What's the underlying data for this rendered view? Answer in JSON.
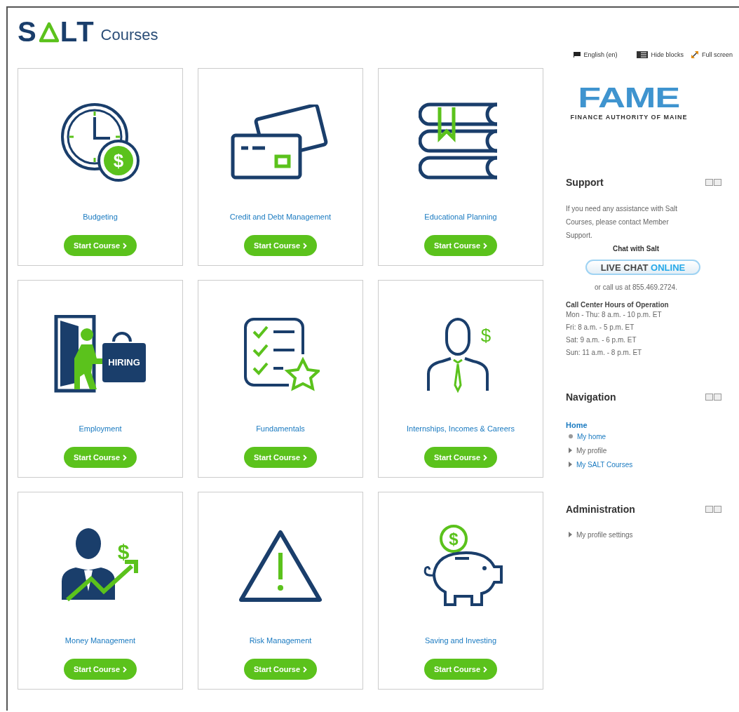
{
  "logo": {
    "start": "S",
    "end": "LT",
    "suffix": "Courses"
  },
  "top_links": [
    {
      "kind": "flag",
      "label": "English (en)"
    },
    {
      "kind": "blocks",
      "label": "Hide blocks"
    },
    {
      "kind": "expand",
      "label": "Full screen"
    }
  ],
  "courses": [
    {
      "kind": "clock",
      "symbol": "$",
      "title": "Budgeting",
      "button": "Start Course"
    },
    {
      "kind": "cards",
      "title": "Credit and Debt Management",
      "button": "Start Course"
    },
    {
      "kind": "books",
      "title": "Educational Planning",
      "button": "Start Course"
    },
    {
      "kind": "hiring",
      "title": "Employment",
      "button": "Start Course",
      "sign": "HIRING"
    },
    {
      "kind": "checklist",
      "title": "Fundamentals",
      "button": "Start Course"
    },
    {
      "kind": "person",
      "symbol": "$",
      "title": "Internships, Incomes & Careers",
      "button": "Start Course"
    },
    {
      "kind": "businessman",
      "symbol": "$",
      "title": "Money Management",
      "button": "Start Course"
    },
    {
      "kind": "warning",
      "title": "Risk Management",
      "button": "Start Course"
    },
    {
      "kind": "piggy",
      "symbol": "$",
      "title": "Saving and Investing",
      "button": "Start Course"
    }
  ],
  "partner_logo": {
    "name": "FAME",
    "tagline": "FINANCE AUTHORITY OF MAINE"
  },
  "support": {
    "title": "Support",
    "text": "If you need any assistance with Salt Courses, please contact Member Support.",
    "chat_label": "Chat with Salt",
    "chat_button": {
      "start": "LIVE CHAT",
      "end": "ONLINE"
    },
    "phone": "or call us at 855.469.2724.",
    "hours_title": "Call Center Hours of Operation",
    "hours": [
      "Mon - Thu: 8 a.m. - 10 p.m. ET",
      "Fri: 8 a.m. - 5 p.m. ET",
      "Sat: 9 a.m. - 6 p.m. ET",
      "Sun: 11 a.m. - 8 p.m. ET"
    ]
  },
  "navigation": {
    "title": "Navigation",
    "items": [
      {
        "label": "Home",
        "link": true,
        "kind": "root",
        "children": [
          {
            "label": "My home",
            "link": true,
            "kind": "leaf"
          },
          {
            "label": "My profile",
            "link": false,
            "kind": "branch"
          },
          {
            "label": "My SALT Courses",
            "link": true,
            "kind": "branch"
          }
        ]
      }
    ]
  },
  "administration": {
    "title": "Administration",
    "items": [
      {
        "label": "My profile settings",
        "link": false,
        "kind": "branch"
      }
    ]
  }
}
